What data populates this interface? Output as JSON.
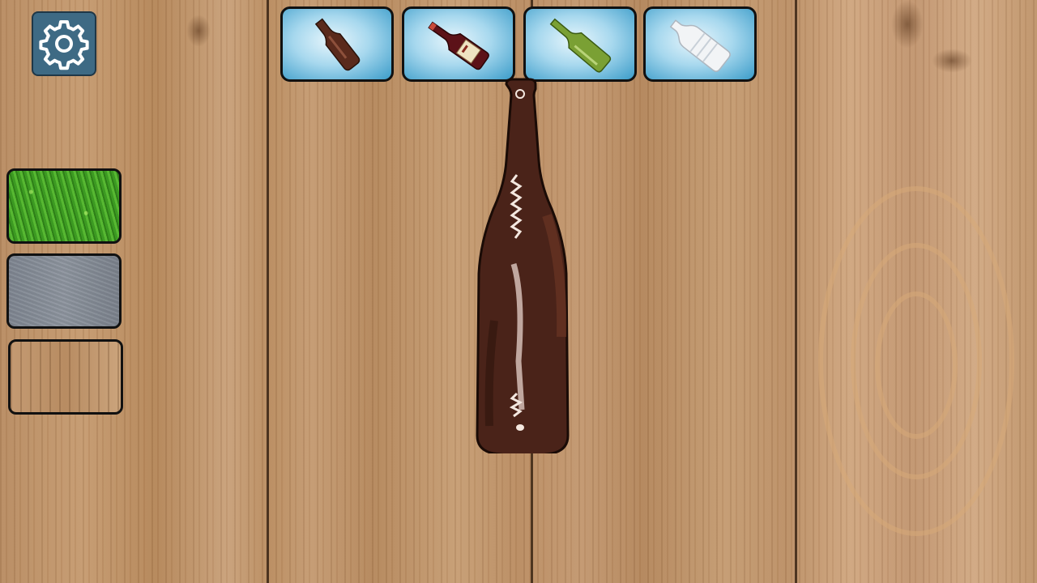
{
  "settings": {
    "icon": "gear-icon",
    "color": "#3e6a84"
  },
  "bottles": [
    {
      "name": "beer-bottle",
      "color": "#5a2a1c",
      "selected": true
    },
    {
      "name": "wine-bottle",
      "color": "#5c1218"
    },
    {
      "name": "green-bottle",
      "color": "#7aa034"
    },
    {
      "name": "plastic-bottle",
      "color": "#f2f4f6"
    }
  ],
  "surfaces": [
    {
      "name": "grass",
      "color": "#48a82a"
    },
    {
      "name": "asphalt",
      "color": "#858c96"
    },
    {
      "name": "wood",
      "color": "#c29770",
      "selected": true
    }
  ],
  "current_bottle": {
    "name": "beer-bottle",
    "color": "#4a2319"
  }
}
